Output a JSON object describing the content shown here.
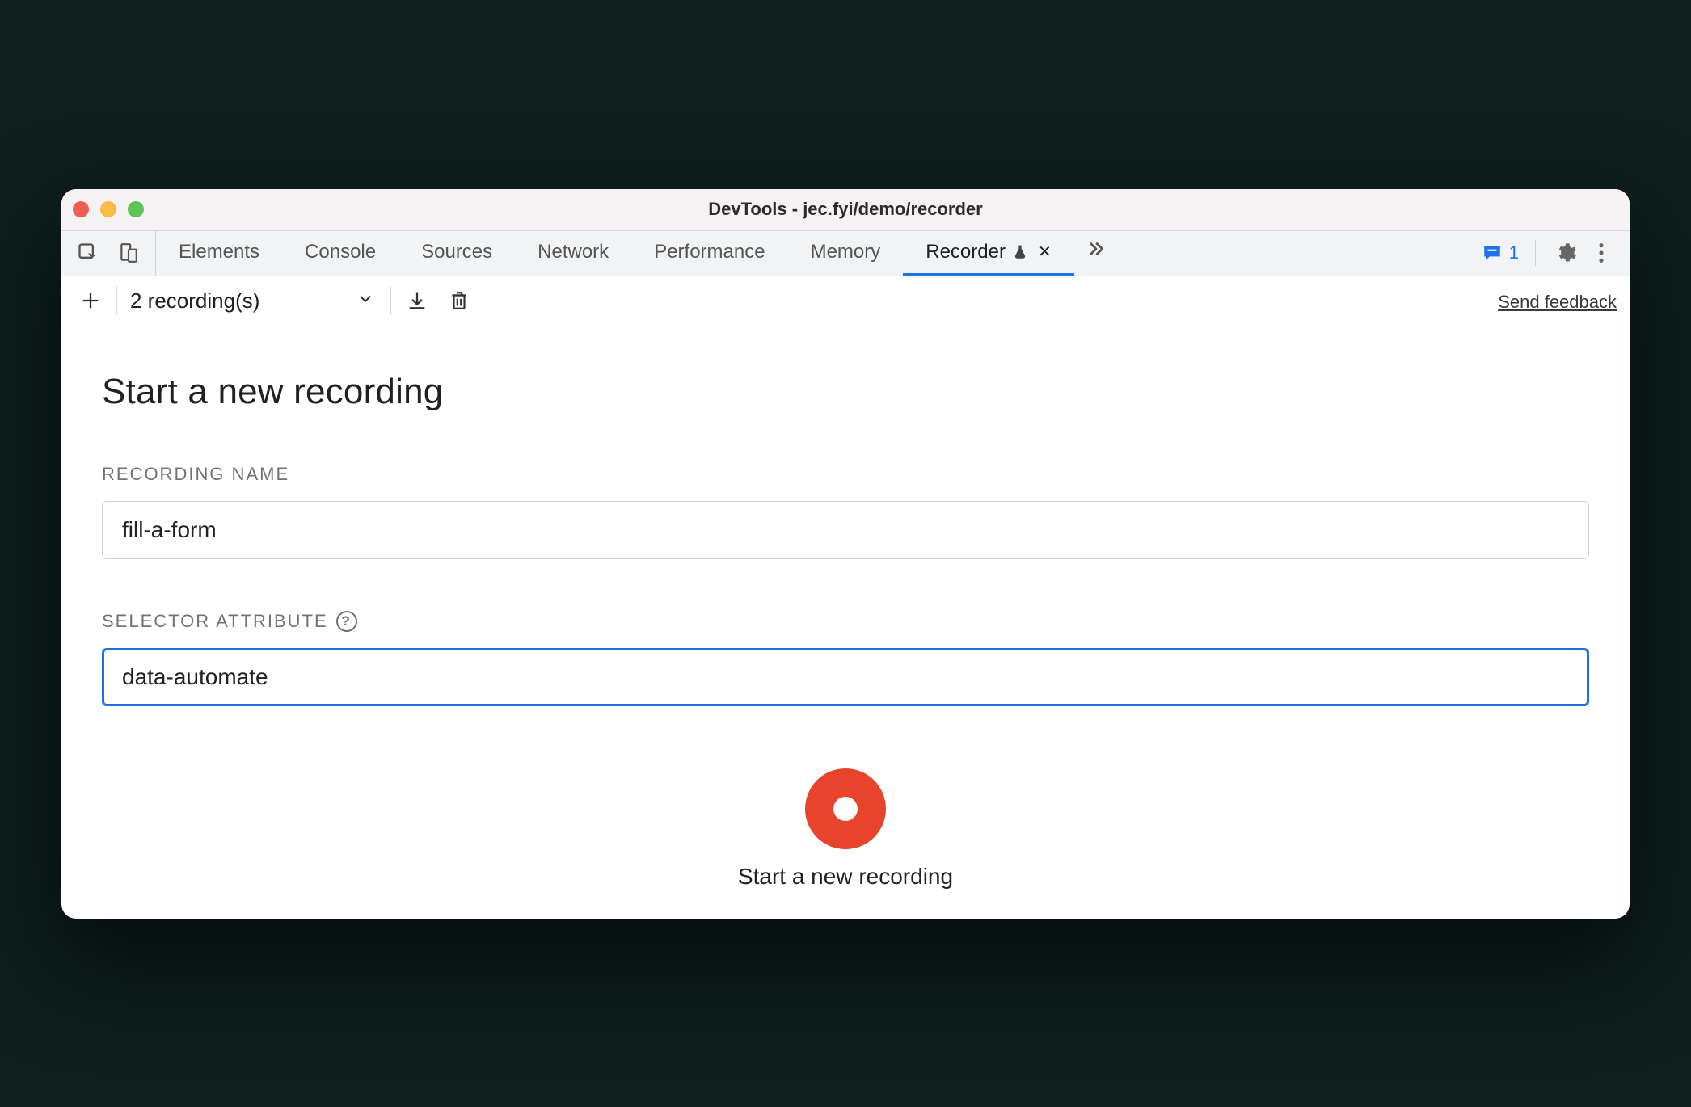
{
  "window": {
    "title": "DevTools - jec.fyi/demo/recorder"
  },
  "tabs": {
    "items": [
      "Elements",
      "Console",
      "Sources",
      "Network",
      "Performance",
      "Memory"
    ],
    "active": {
      "label": "Recorder"
    }
  },
  "issues": {
    "count": "1"
  },
  "toolbar": {
    "dropdown_label": "2 recording(s)",
    "feedback": "Send feedback"
  },
  "main": {
    "heading": "Start a new recording",
    "recording_name_label": "RECORDING NAME",
    "recording_name_value": "fill-a-form",
    "selector_label": "SELECTOR ATTRIBUTE",
    "selector_value": "data-automate"
  },
  "footer": {
    "record_label": "Start a new recording"
  }
}
